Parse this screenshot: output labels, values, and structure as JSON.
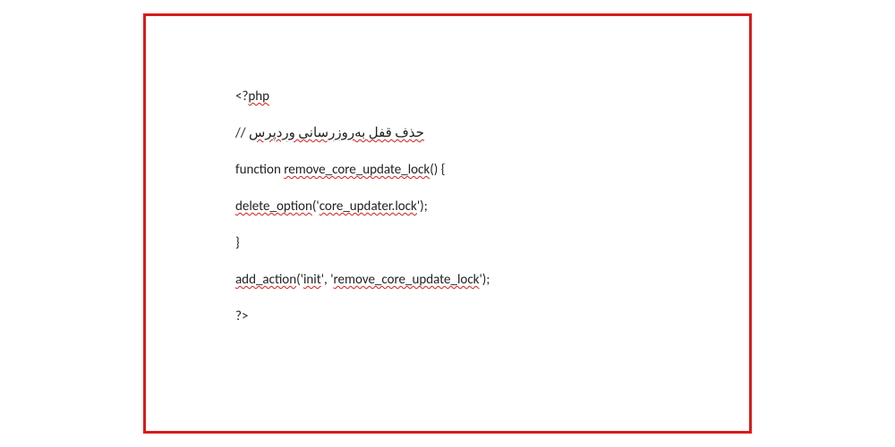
{
  "code": {
    "line1_prefix": "<?",
    "line1_squiggle": "php",
    "line2_prefix": "// ",
    "line2_text": "حذف قفل به‌روزرسانی وردپرس",
    "line3_prefix": "function ",
    "line3_squiggle": "remove_core_update_lock",
    "line3_suffix": "() {",
    "line4_squiggle": "delete_option",
    "line4_mid": "('",
    "line4_squiggle2": "core_updater.lock",
    "line4_suffix": "');",
    "line5": "}",
    "line6_squiggle": "add_action",
    "line6_mid": "('",
    "line6_squiggle2": "init",
    "line6_mid2": "', '",
    "line6_squiggle3": "remove_core_update_lock",
    "line6_suffix": "');",
    "line7": "?>"
  }
}
